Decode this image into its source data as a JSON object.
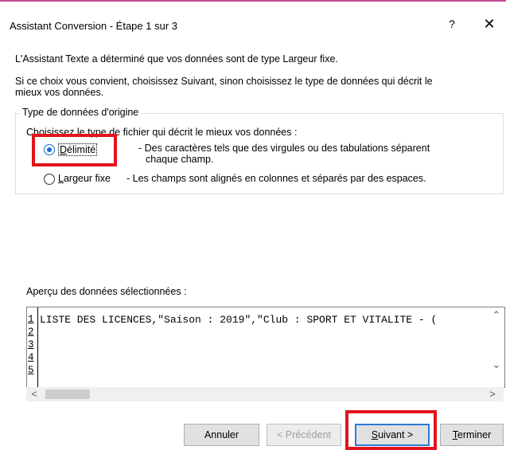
{
  "dialog": {
    "title": "Assistant Conversion - Étape 1 sur 3",
    "help": "?",
    "close": "✕"
  },
  "intro": {
    "line1": "L'Assistant Texte a déterminé que vos données sont de type Largeur fixe.",
    "line2": "Si ce choix vous convient, choisissez Suivant, sinon choisissez le type de données qui décrit le",
    "line3": "mieux vos données."
  },
  "group": {
    "legend": "Type de données d'origine",
    "prompt": "Choisissez le type de fichier qui décrit le mieux vos données :",
    "options": [
      {
        "label_prefix": "D",
        "label_rest": "élimité",
        "desc1": "- Des caractères tels que des virgules ou des tabulations séparent",
        "desc2": "chaque champ.",
        "checked": true
      },
      {
        "label_prefix": "L",
        "label_rest": "argeur fixe",
        "desc1": "- Les champs sont alignés en colonnes et séparés par des espaces.",
        "checked": false
      }
    ]
  },
  "preview": {
    "label": "Aperçu des données sélectionnées :",
    "line_numbers": [
      "1",
      "2",
      "3",
      "4",
      "5"
    ],
    "lines": [
      "LISTE DES LICENCES,\"Saison : 2019\",\"Club : SPORT ET VITALITE - (",
      "",
      "",
      "",
      ""
    ]
  },
  "buttons": {
    "cancel": "Annuler",
    "previous": "< Précédent",
    "next_prefix": "S",
    "next_rest": "uivant >",
    "finish_prefix": "T",
    "finish_rest": "erminer"
  },
  "colors": {
    "highlight": "#e2141c",
    "accent": "#1b6ac9",
    "title_accent": "#c04a92"
  }
}
